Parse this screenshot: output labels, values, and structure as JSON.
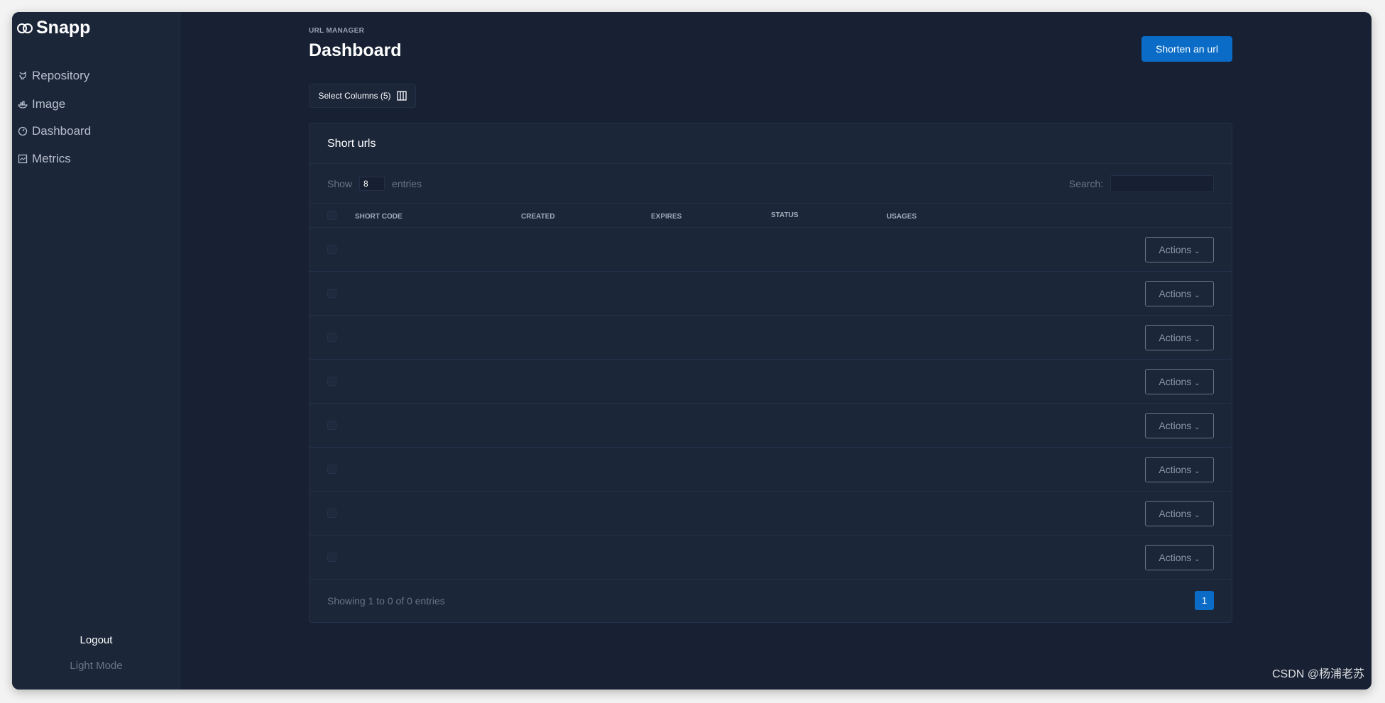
{
  "app": {
    "name": "Snapp",
    "logo_icon": "link-rings-icon"
  },
  "sidebar": {
    "items": [
      {
        "label": "Repository",
        "icon": "github-icon"
      },
      {
        "label": "Image",
        "icon": "docker-icon"
      },
      {
        "label": "Dashboard",
        "icon": "gauge-icon"
      },
      {
        "label": "Metrics",
        "icon": "chart-icon"
      }
    ],
    "logout": "Logout",
    "theme_toggle": "Light Mode"
  },
  "header": {
    "breadcrumb": "URL MANAGER",
    "title": "Dashboard",
    "shorten_label": "Shorten an url",
    "select_columns": "Select Columns (5)"
  },
  "card": {
    "title": "Short urls",
    "show": "Show",
    "page_size": "8",
    "entries": "entries",
    "search_label": "Search:",
    "search_value": "",
    "columns": [
      "SHORT CODE",
      "CREATED",
      "EXPIRES",
      "STATUS",
      "USAGES"
    ],
    "row_count": 8,
    "action_label": "Actions",
    "footer": "Showing 1 to 0 of 0 entries",
    "page": "1"
  },
  "watermark": "CSDN @杨浦老苏",
  "colors": {
    "accent": "#0a6cc6",
    "sidebar": "#1b2639",
    "background": "#172133"
  }
}
